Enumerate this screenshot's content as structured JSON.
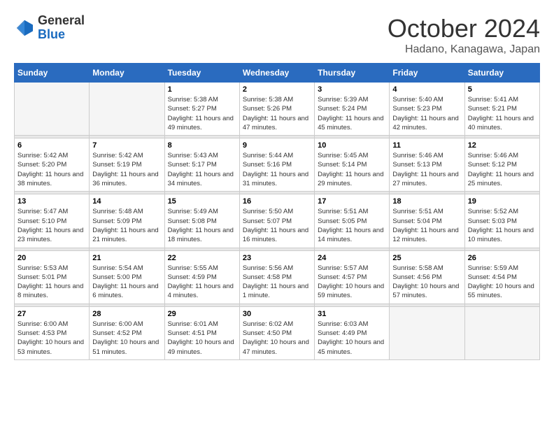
{
  "logo": {
    "general": "General",
    "blue": "Blue"
  },
  "header": {
    "month": "October 2024",
    "location": "Hadano, Kanagawa, Japan"
  },
  "weekdays": [
    "Sunday",
    "Monday",
    "Tuesday",
    "Wednesday",
    "Thursday",
    "Friday",
    "Saturday"
  ],
  "weeks": [
    [
      {
        "day": "",
        "info": ""
      },
      {
        "day": "",
        "info": ""
      },
      {
        "day": "1",
        "info": "Sunrise: 5:38 AM\nSunset: 5:27 PM\nDaylight: 11 hours and 49 minutes."
      },
      {
        "day": "2",
        "info": "Sunrise: 5:38 AM\nSunset: 5:26 PM\nDaylight: 11 hours and 47 minutes."
      },
      {
        "day": "3",
        "info": "Sunrise: 5:39 AM\nSunset: 5:24 PM\nDaylight: 11 hours and 45 minutes."
      },
      {
        "day": "4",
        "info": "Sunrise: 5:40 AM\nSunset: 5:23 PM\nDaylight: 11 hours and 42 minutes."
      },
      {
        "day": "5",
        "info": "Sunrise: 5:41 AM\nSunset: 5:21 PM\nDaylight: 11 hours and 40 minutes."
      }
    ],
    [
      {
        "day": "6",
        "info": "Sunrise: 5:42 AM\nSunset: 5:20 PM\nDaylight: 11 hours and 38 minutes."
      },
      {
        "day": "7",
        "info": "Sunrise: 5:42 AM\nSunset: 5:19 PM\nDaylight: 11 hours and 36 minutes."
      },
      {
        "day": "8",
        "info": "Sunrise: 5:43 AM\nSunset: 5:17 PM\nDaylight: 11 hours and 34 minutes."
      },
      {
        "day": "9",
        "info": "Sunrise: 5:44 AM\nSunset: 5:16 PM\nDaylight: 11 hours and 31 minutes."
      },
      {
        "day": "10",
        "info": "Sunrise: 5:45 AM\nSunset: 5:14 PM\nDaylight: 11 hours and 29 minutes."
      },
      {
        "day": "11",
        "info": "Sunrise: 5:46 AM\nSunset: 5:13 PM\nDaylight: 11 hours and 27 minutes."
      },
      {
        "day": "12",
        "info": "Sunrise: 5:46 AM\nSunset: 5:12 PM\nDaylight: 11 hours and 25 minutes."
      }
    ],
    [
      {
        "day": "13",
        "info": "Sunrise: 5:47 AM\nSunset: 5:10 PM\nDaylight: 11 hours and 23 minutes."
      },
      {
        "day": "14",
        "info": "Sunrise: 5:48 AM\nSunset: 5:09 PM\nDaylight: 11 hours and 21 minutes."
      },
      {
        "day": "15",
        "info": "Sunrise: 5:49 AM\nSunset: 5:08 PM\nDaylight: 11 hours and 18 minutes."
      },
      {
        "day": "16",
        "info": "Sunrise: 5:50 AM\nSunset: 5:07 PM\nDaylight: 11 hours and 16 minutes."
      },
      {
        "day": "17",
        "info": "Sunrise: 5:51 AM\nSunset: 5:05 PM\nDaylight: 11 hours and 14 minutes."
      },
      {
        "day": "18",
        "info": "Sunrise: 5:51 AM\nSunset: 5:04 PM\nDaylight: 11 hours and 12 minutes."
      },
      {
        "day": "19",
        "info": "Sunrise: 5:52 AM\nSunset: 5:03 PM\nDaylight: 11 hours and 10 minutes."
      }
    ],
    [
      {
        "day": "20",
        "info": "Sunrise: 5:53 AM\nSunset: 5:01 PM\nDaylight: 11 hours and 8 minutes."
      },
      {
        "day": "21",
        "info": "Sunrise: 5:54 AM\nSunset: 5:00 PM\nDaylight: 11 hours and 6 minutes."
      },
      {
        "day": "22",
        "info": "Sunrise: 5:55 AM\nSunset: 4:59 PM\nDaylight: 11 hours and 4 minutes."
      },
      {
        "day": "23",
        "info": "Sunrise: 5:56 AM\nSunset: 4:58 PM\nDaylight: 11 hours and 1 minute."
      },
      {
        "day": "24",
        "info": "Sunrise: 5:57 AM\nSunset: 4:57 PM\nDaylight: 10 hours and 59 minutes."
      },
      {
        "day": "25",
        "info": "Sunrise: 5:58 AM\nSunset: 4:56 PM\nDaylight: 10 hours and 57 minutes."
      },
      {
        "day": "26",
        "info": "Sunrise: 5:59 AM\nSunset: 4:54 PM\nDaylight: 10 hours and 55 minutes."
      }
    ],
    [
      {
        "day": "27",
        "info": "Sunrise: 6:00 AM\nSunset: 4:53 PM\nDaylight: 10 hours and 53 minutes."
      },
      {
        "day": "28",
        "info": "Sunrise: 6:00 AM\nSunset: 4:52 PM\nDaylight: 10 hours and 51 minutes."
      },
      {
        "day": "29",
        "info": "Sunrise: 6:01 AM\nSunset: 4:51 PM\nDaylight: 10 hours and 49 minutes."
      },
      {
        "day": "30",
        "info": "Sunrise: 6:02 AM\nSunset: 4:50 PM\nDaylight: 10 hours and 47 minutes."
      },
      {
        "day": "31",
        "info": "Sunrise: 6:03 AM\nSunset: 4:49 PM\nDaylight: 10 hours and 45 minutes."
      },
      {
        "day": "",
        "info": ""
      },
      {
        "day": "",
        "info": ""
      }
    ]
  ]
}
